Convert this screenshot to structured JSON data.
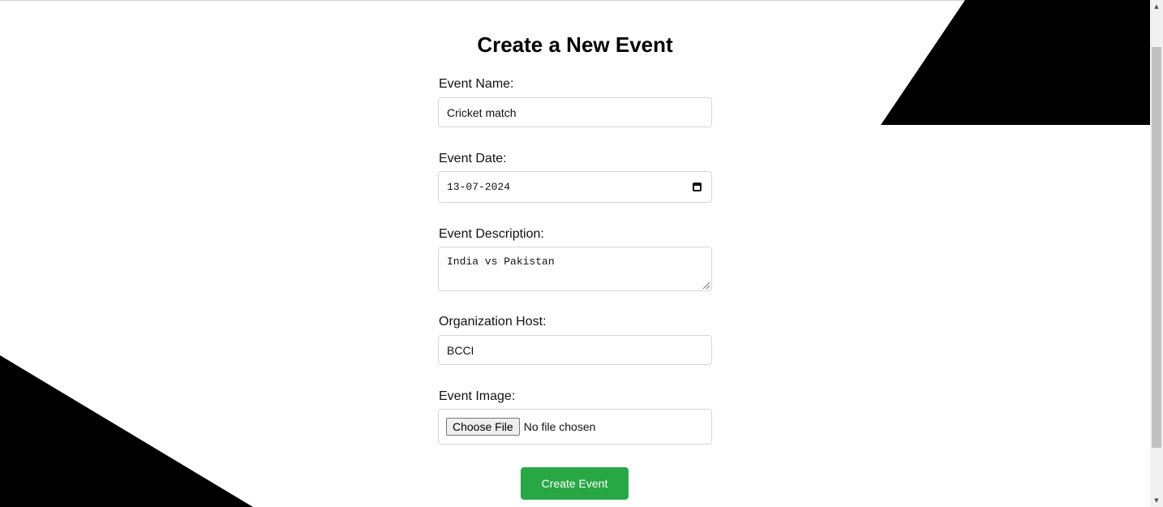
{
  "form": {
    "title": "Create a New Event",
    "event_name": {
      "label": "Event Name:",
      "value": "Cricket match"
    },
    "event_date": {
      "label": "Event Date:",
      "value": "13-07-2024"
    },
    "event_description": {
      "label": "Event Description:",
      "value": "India vs Pakistan"
    },
    "organization_host": {
      "label": "Organization Host:",
      "value": "BCCI"
    },
    "event_image": {
      "label": "Event Image:",
      "button_label": "Choose File",
      "status": "No file chosen"
    },
    "submit_label": "Create Event"
  },
  "icons": {
    "date_picker": "calendar-icon",
    "scroll_up": "scroll-up-arrow-icon",
    "scroll_down": "scroll-down-arrow-icon"
  },
  "colors": {
    "submit_button": "#28a745",
    "decoration": "#000000",
    "field_border": "#d7d7d7"
  }
}
